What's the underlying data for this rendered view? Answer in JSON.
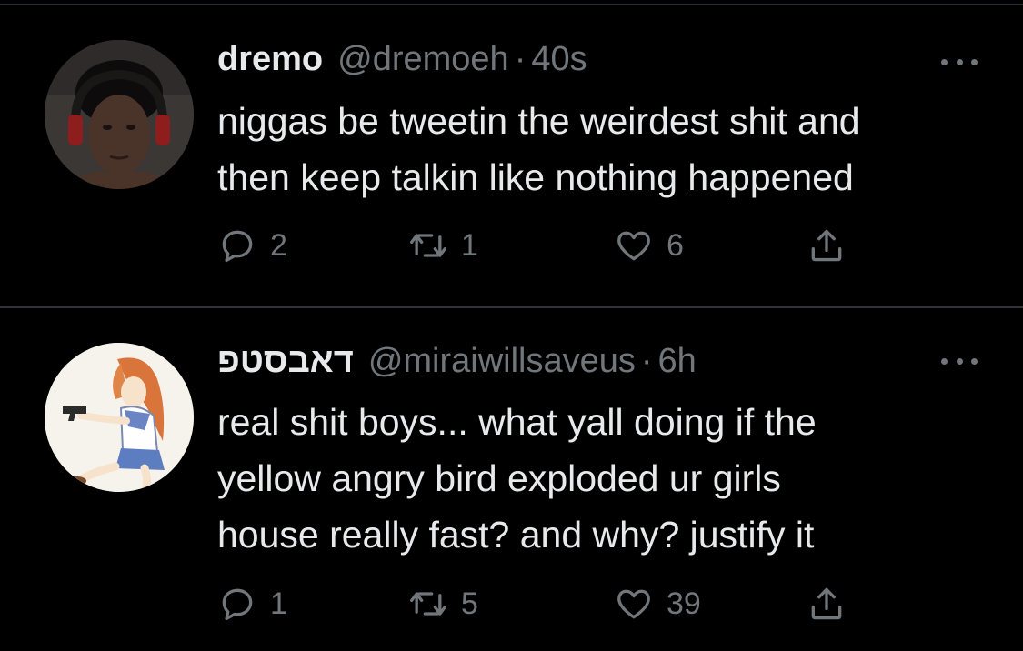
{
  "tweets": [
    {
      "display_name": "dremo",
      "handle": "@dremoeh",
      "dot": "·",
      "time": "40s",
      "text_lines": [
        "niggas be tweetin the weirdest shit and",
        "then keep talkin like nothing happened"
      ],
      "replies": "2",
      "retweets": "1",
      "likes": "6"
    },
    {
      "display_name": "דאבסטפ",
      "handle": "@miraiwillsaveus",
      "dot": "·",
      "time": "6h",
      "text_lines": [
        "real shit boys... what yall doing if the",
        "yellow angry bird exploded ur girls",
        "house really fast? and why? justify it"
      ],
      "replies": "1",
      "retweets": "5",
      "likes": "39"
    }
  ],
  "icons": {
    "reply": "reply-icon",
    "retweet": "retweet-icon",
    "like": "heart-icon",
    "share": "share-icon",
    "more": "more-icon"
  },
  "colors": {
    "background": "#000000",
    "text": "#e7e9ea",
    "secondary": "#71767b",
    "divider": "#2f3336"
  }
}
